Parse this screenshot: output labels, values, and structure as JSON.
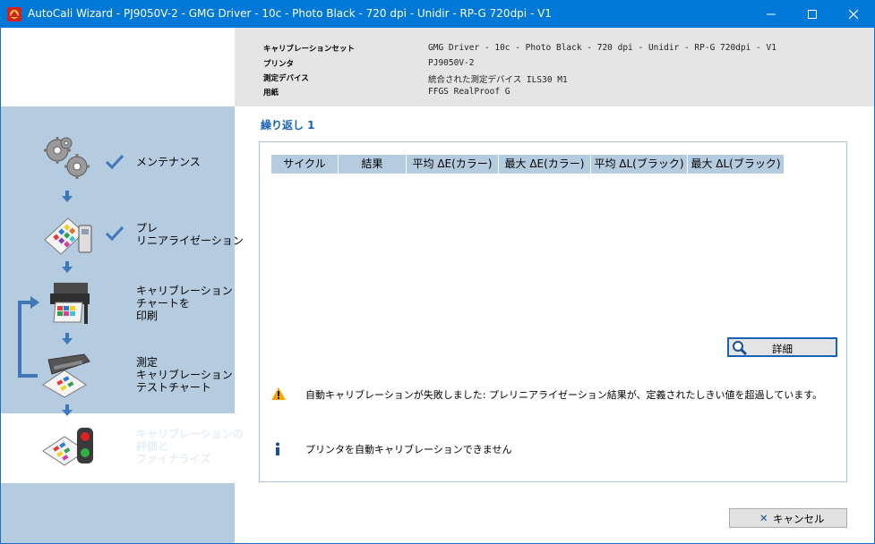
{
  "window": {
    "title": "AutoCali Wizard - PJ9050V-2 - GMG Driver - 10c - Photo Black - 720 dpi - Unidir - RP-G 720dpi - V1",
    "minimize": "─",
    "maximize": "☐",
    "close": "✕"
  },
  "info": {
    "calibration_set_label": "キャリブレーションセット",
    "calibration_set_value": "GMG Driver - 10c - Photo Black - 720 dpi - Unidir - RP-G 720dpi - V1",
    "printer_label": "プリンタ",
    "printer_value": "PJ9050V-2",
    "device_label": "測定デバイス",
    "device_value": "統合された測定デバイス ILS30 M1",
    "paper_label": "用紙",
    "paper_value": "FFGS RealProof G"
  },
  "steps": [
    {
      "label": "メンテナンス",
      "done": true
    },
    {
      "label": "プレ\nリニアライゼーション",
      "done": true
    },
    {
      "label": "キャリブレーション\nチャートを\n印刷",
      "done": false
    },
    {
      "label": "測定\nキャリブレーション\nテストチャート",
      "done": false
    },
    {
      "label": "キャリブレーションの\n評価と\nファイナライズ",
      "done": false
    }
  ],
  "main": {
    "iteration": "繰り返し 1",
    "table_columns": [
      "サイクル",
      "結果",
      "平均 ΔE(カラー)",
      "最大 ΔE(カラー)",
      "平均 ΔL(ブラック)",
      "最大 ΔL(ブラック)"
    ],
    "detail_button": "詳細",
    "warning_message": "自動キャリブレーションが失敗しました: プレリニアライゼーション結果が、定義されたしきい値を超過しています。",
    "info_message": "プリンタを自動キャリブレーションできません",
    "cancel_button": "キャンセル"
  },
  "colors": {
    "titlebar": "#0078d7",
    "sidebar": "#b4cbe0",
    "accent": "#1a64b6",
    "warning": "#f0a800"
  }
}
